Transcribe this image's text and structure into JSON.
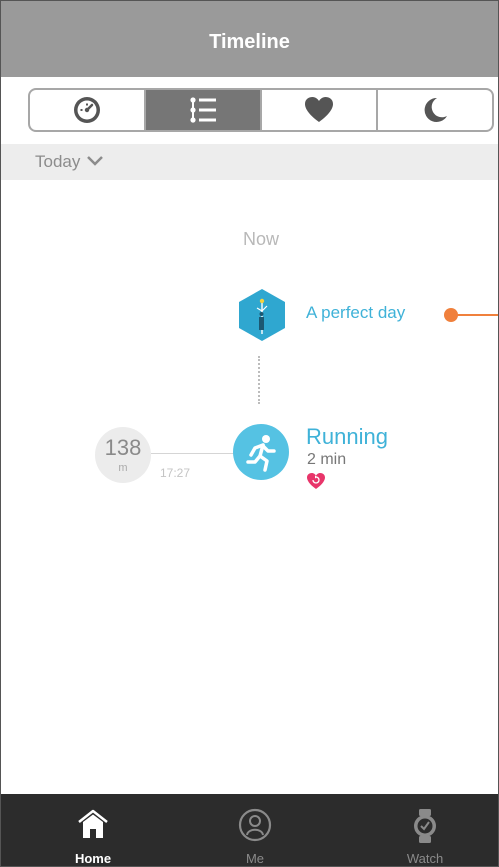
{
  "header": {
    "title": "Timeline"
  },
  "segments": [
    {
      "icon": "speedometer-icon",
      "active": false
    },
    {
      "icon": "timeline-list-icon",
      "active": true
    },
    {
      "icon": "heart-icon",
      "active": false
    },
    {
      "icon": "moon-icon",
      "active": false
    }
  ],
  "date_filter": {
    "label": "Today"
  },
  "timeline": {
    "now_label": "Now",
    "goal_event": {
      "title": "A perfect day",
      "icon": "goal-achieved-icon"
    },
    "activity": {
      "title": "Running",
      "duration": "2 min",
      "distance_value": "138",
      "distance_unit": "m",
      "time": "17:27",
      "icon": "running-icon",
      "badge_icon": "heart-rate-badge-icon"
    }
  },
  "tabbar": {
    "tabs": [
      {
        "label": "Home",
        "icon": "home-icon",
        "active": true
      },
      {
        "label": "Me",
        "icon": "profile-icon",
        "active": false
      },
      {
        "label": "Watch",
        "icon": "watch-icon",
        "active": false
      }
    ]
  },
  "colors": {
    "header_bg": "#9a9a9a",
    "accent_blue": "#3fb2d8",
    "orange_pointer": "#f0803c",
    "tabbar_bg": "#2c2c2c"
  }
}
